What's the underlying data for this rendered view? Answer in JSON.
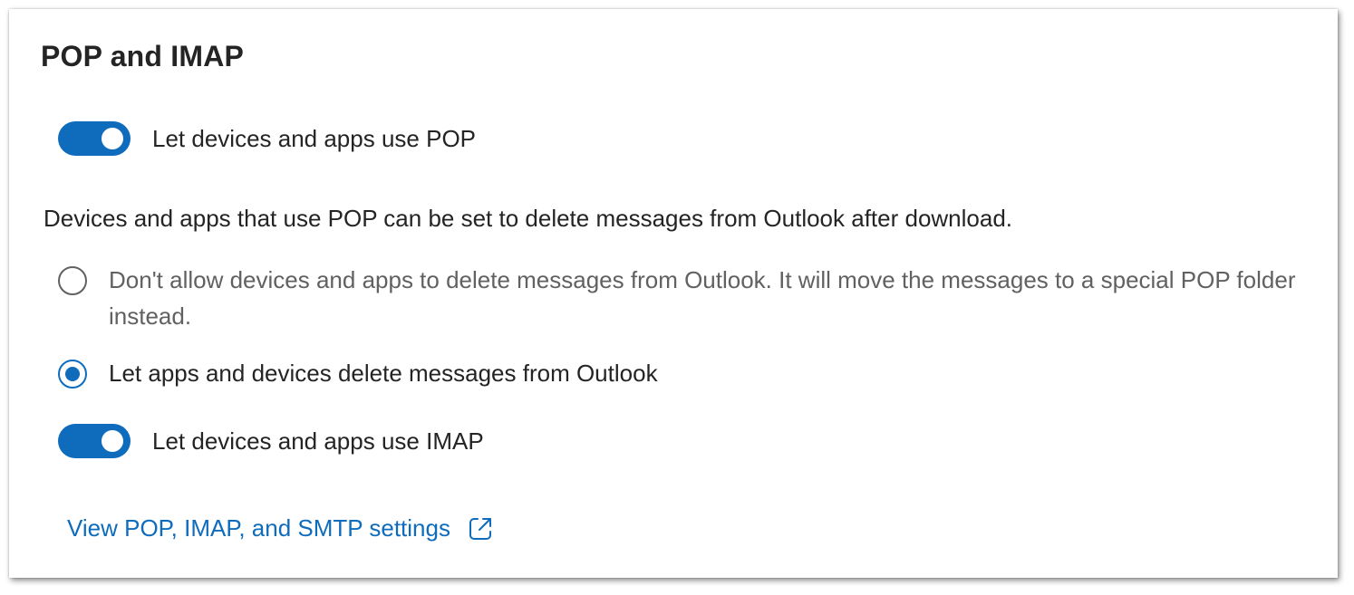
{
  "section": {
    "title": "POP and IMAP"
  },
  "pop_toggle": {
    "label": "Let devices and apps use POP",
    "state": "on"
  },
  "description": "Devices and apps that use POP can be set to delete messages from Outlook after download.",
  "delete_options": [
    {
      "label": "Don't allow devices and apps to delete messages from Outlook. It will move the messages to a special POP folder instead.",
      "selected": false
    },
    {
      "label": "Let apps and devices delete messages from Outlook",
      "selected": true
    }
  ],
  "imap_toggle": {
    "label": "Let devices and apps use IMAP",
    "state": "on"
  },
  "settings_link": {
    "label": "View POP, IMAP, and SMTP settings",
    "icon": "external-link-icon"
  },
  "colors": {
    "accent": "#0f6cbd",
    "text": "#242424",
    "muted_text": "#616161"
  }
}
